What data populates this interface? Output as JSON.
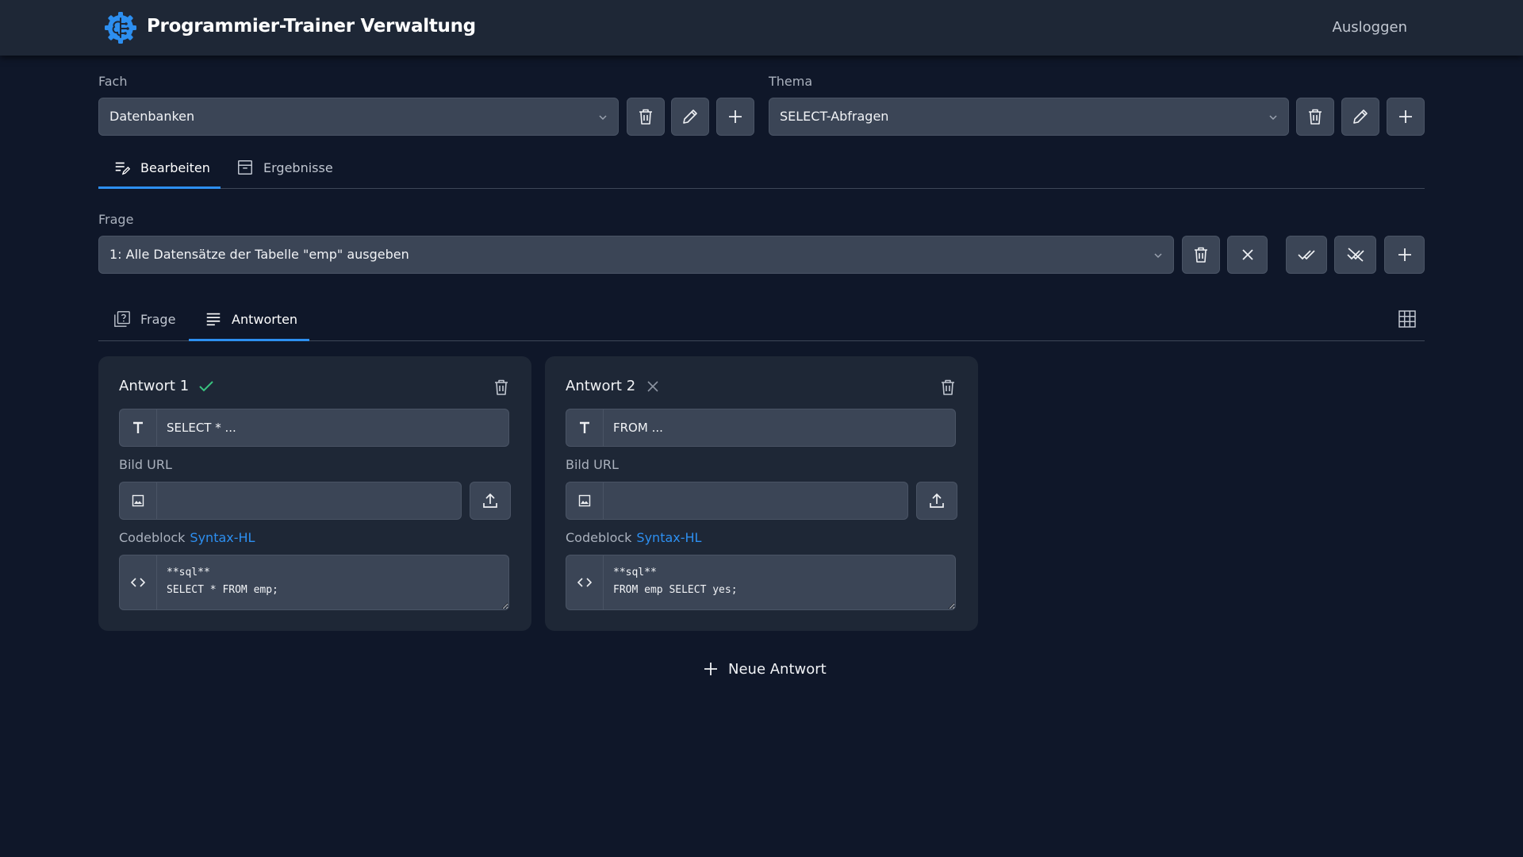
{
  "header": {
    "title": "Programmier-Trainer Verwaltung",
    "logout_label": "Ausloggen"
  },
  "subject": {
    "label": "Fach",
    "value": "Datenbanken"
  },
  "topic": {
    "label": "Thema",
    "value": "SELECT-Abfragen"
  },
  "main_tabs": [
    {
      "label": "Bearbeiten",
      "icon": "edit-list-icon",
      "active": true
    },
    {
      "label": "Ergebnisse",
      "icon": "archive-icon",
      "active": false
    }
  ],
  "question": {
    "label": "Frage",
    "value": "1: Alle Datensätze der Tabelle \"emp\" ausgeben"
  },
  "question_tabs": [
    {
      "label": "Frage",
      "icon": "question-box-icon",
      "active": false
    },
    {
      "label": "Antworten",
      "icon": "list-lines-icon",
      "active": true
    }
  ],
  "answers": [
    {
      "title": "Antwort 1",
      "correct": true,
      "text": "SELECT * ...",
      "image_label": "Bild URL",
      "image_url": "",
      "codeblock_label": "Codeblock",
      "syntax_link": "Syntax-HL",
      "code": "**sql**\nSELECT * FROM emp;"
    },
    {
      "title": "Antwort 2",
      "correct": false,
      "text": "FROM ...",
      "image_label": "Bild URL",
      "image_url": "",
      "codeblock_label": "Codeblock",
      "syntax_link": "Syntax-HL",
      "code": "**sql**\nFROM emp SELECT yes;"
    }
  ],
  "new_answer_label": "Neue Antwort",
  "colors": {
    "accent": "#2d8ff0",
    "correct": "#39c27f",
    "background": "#0f1729",
    "card": "#1e2736"
  }
}
